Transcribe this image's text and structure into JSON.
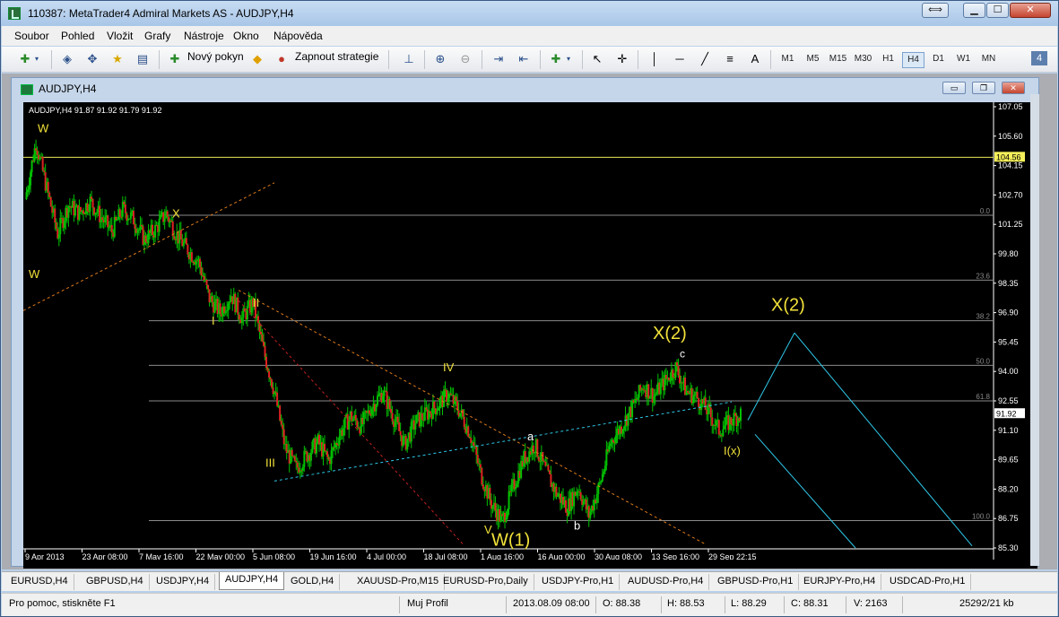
{
  "window": {
    "title": "110387: MetaTrader4 Admiral Markets AS - AUDJPY,H4",
    "restore_glyph": "⟺",
    "min_glyph": "▁",
    "max_glyph": "☐",
    "close_glyph": "✕"
  },
  "menu": [
    "Soubor",
    "Pohled",
    "Vložit",
    "Grafy",
    "Nástroje",
    "Okno",
    "Nápověda"
  ],
  "toolbar": {
    "new_order": "Nový pokyn",
    "autotrading": "Zapnout strategie",
    "line_tool_label": "A",
    "timeframes": [
      "M1",
      "M5",
      "M15",
      "M30",
      "H1",
      "H4",
      "D1",
      "W1",
      "MN"
    ],
    "active_timeframe": "H4",
    "badge": "4"
  },
  "chart_window": {
    "title": "AUDJPY,H4",
    "info": "AUDJPY,H4  91.87 91.92 91.79 91.92",
    "min_glyph": "▭",
    "max_glyph": "❐",
    "close_glyph": "✕"
  },
  "chart_data": {
    "type": "candlestick",
    "symbol": "AUDJPY",
    "timeframe": "H4",
    "price_axis_ticks": [
      "107.05",
      "105.60",
      "104.15",
      "102.70",
      "101.25",
      "99.80",
      "98.35",
      "96.90",
      "95.45",
      "94.00",
      "92.55",
      "91.10",
      "89.65",
      "88.20",
      "86.75",
      "85.30"
    ],
    "price_range": [
      85.3,
      107.05
    ],
    "time_axis_ticks": [
      "9 Apr 2013",
      "23 Apr 08:00",
      "7 May 16:00",
      "22 May 00:00",
      "5 Jun 08:00",
      "19 Jun 16:00",
      "4 Jul 00:00",
      "18 Jul 08:00",
      "1 Aug 16:00",
      "16 Aug 00:00",
      "30 Aug 08:00",
      "13 Sep 16:00",
      "29 Sep 22:15"
    ],
    "current_price": "91.92",
    "horizontal_line_price": "104.56",
    "fibonacci_levels": [
      {
        "label": "0.0",
        "price": 101.7
      },
      {
        "label": "23.6",
        "price": 98.5
      },
      {
        "label": "38.2",
        "price": 96.5
      },
      {
        "label": "50.0",
        "price": 94.3
      },
      {
        "label": "61.8",
        "price": 92.55
      },
      {
        "label": "100.0",
        "price": 86.65
      }
    ],
    "wave_labels": [
      {
        "text": "W",
        "x_date": "Apr",
        "price": 105.8
      },
      {
        "text": "W",
        "price": 98.6
      },
      {
        "text": "X",
        "price": 101.5
      },
      {
        "text": "I",
        "price": 96.3
      },
      {
        "text": "II",
        "price": 97.2
      },
      {
        "text": "III",
        "price": 89.3
      },
      {
        "text": "IV",
        "price": 94.0
      },
      {
        "text": "V",
        "price": 86.0
      },
      {
        "text": "W(1)",
        "price": 85.4
      },
      {
        "text": "a",
        "price": 90.6
      },
      {
        "text": "b",
        "price": 86.2
      },
      {
        "text": "c",
        "price": 94.7
      },
      {
        "text": "X(2)",
        "price": 95.6
      },
      {
        "text": "I(x)",
        "price": 89.9
      },
      {
        "text": "X(2)",
        "price": 97.0
      }
    ],
    "series": [
      {
        "name": "AUDJPY",
        "close": [
          102.5,
          105.3,
          103.0,
          100.8,
          102.2,
          101.8,
          102.4,
          101.6,
          100.9,
          102.0,
          101.5,
          100.5,
          101.0,
          101.8,
          100.7,
          100.0,
          99.4,
          97.6,
          96.9,
          97.8,
          96.6,
          97.4,
          95.0,
          93.0,
          90.2,
          89.2,
          89.9,
          90.5,
          89.6,
          90.9,
          91.8,
          91.3,
          92.3,
          93.0,
          91.7,
          90.4,
          91.5,
          91.9,
          92.3,
          92.9,
          92.1,
          91.0,
          89.0,
          87.5,
          86.6,
          88.3,
          89.7,
          90.4,
          89.1,
          88.0,
          87.3,
          88.3,
          86.9,
          88.4,
          90.5,
          91.3,
          92.2,
          93.3,
          92.8,
          93.5,
          94.2,
          93.0,
          92.7,
          92.0,
          91.1,
          91.5,
          91.92
        ]
      }
    ]
  },
  "tabs": [
    "EURUSD,H4",
    "GBPUSD,H4",
    "USDJPY,H4",
    "AUDJPY,H4",
    "GOLD,H4",
    "XAUUSD-Pro,M15",
    "EURUSD-Pro,Daily",
    "USDJPY-Pro,H1",
    "AUDUSD-Pro,H4",
    "GBPUSD-Pro,H1",
    "EURJPY-Pro,H4",
    "USDCAD-Pro,H1"
  ],
  "active_tab": "AUDJPY,H4",
  "status": {
    "help": "Pro pomoc, stiskněte F1",
    "profile": "Muj Profil",
    "datetime": "2013.08.09 08:00",
    "open": "O: 88.38",
    "high": "H: 88.53",
    "low": "L: 88.29",
    "close": "C: 88.31",
    "volume": "V: 2163",
    "traffic": "25292/21 kb"
  }
}
